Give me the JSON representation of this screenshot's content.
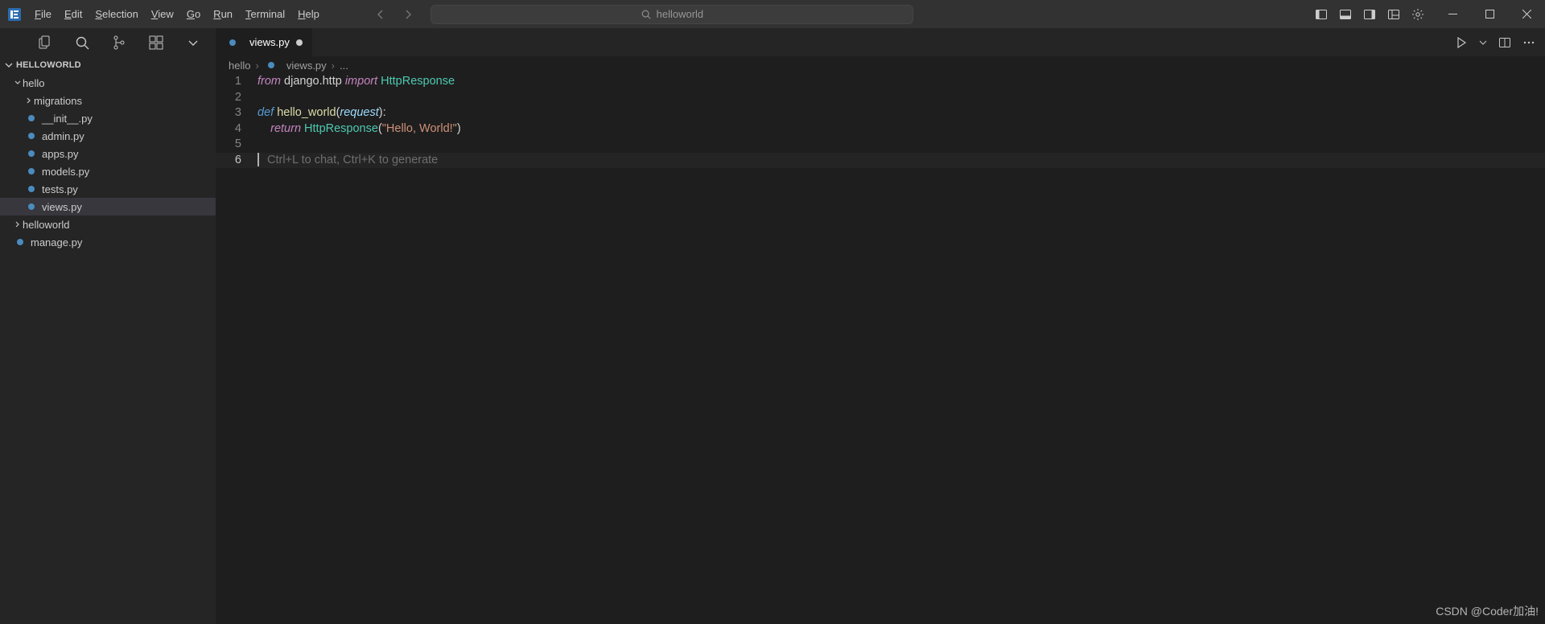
{
  "menubar": {
    "items": [
      {
        "label": "File",
        "mn": "F"
      },
      {
        "label": "Edit",
        "mn": "E"
      },
      {
        "label": "Selection",
        "mn": "S"
      },
      {
        "label": "View",
        "mn": "V"
      },
      {
        "label": "Go",
        "mn": "G"
      },
      {
        "label": "Run",
        "mn": "R"
      },
      {
        "label": "Terminal",
        "mn": "T"
      },
      {
        "label": "Help",
        "mn": "H"
      }
    ]
  },
  "search": {
    "text": "helloworld"
  },
  "explorer": {
    "title": "HELLOWORLD",
    "tree": [
      {
        "type": "folder",
        "label": "hello",
        "depth": 1,
        "open": true
      },
      {
        "type": "folder",
        "label": "migrations",
        "depth": 2,
        "open": false
      },
      {
        "type": "file",
        "label": "__init__.py",
        "depth": 2
      },
      {
        "type": "file",
        "label": "admin.py",
        "depth": 2
      },
      {
        "type": "file",
        "label": "apps.py",
        "depth": 2
      },
      {
        "type": "file",
        "label": "models.py",
        "depth": 2
      },
      {
        "type": "file",
        "label": "tests.py",
        "depth": 2
      },
      {
        "type": "file",
        "label": "views.py",
        "depth": 2,
        "active": true
      },
      {
        "type": "folder",
        "label": "helloworld",
        "depth": 1,
        "open": false
      },
      {
        "type": "file",
        "label": "manage.py",
        "depth": 1
      }
    ]
  },
  "tabs": {
    "open": [
      {
        "label": "views.py",
        "dirty": true
      }
    ]
  },
  "breadcrumb": {
    "parts": [
      "hello",
      "views.py",
      "..."
    ]
  },
  "editor": {
    "ghost_hint": "Ctrl+L to chat, Ctrl+K to generate",
    "current_line": 6,
    "lines": [
      {
        "n": 1,
        "tokens": [
          [
            "kw-imp",
            "from"
          ],
          [
            "mod",
            " django.http "
          ],
          [
            "kw-imp",
            "import"
          ],
          [
            "mod",
            " "
          ],
          [
            "cls",
            "HttpResponse"
          ]
        ]
      },
      {
        "n": 2,
        "tokens": []
      },
      {
        "n": 3,
        "tokens": [
          [
            "kw-def",
            "def"
          ],
          [
            "mod",
            " "
          ],
          [
            "fn",
            "hello_world"
          ],
          [
            "punct",
            "("
          ],
          [
            "param",
            "request"
          ],
          [
            "punct",
            "):"
          ]
        ]
      },
      {
        "n": 4,
        "tokens": [
          [
            "mod",
            "    "
          ],
          [
            "kw-ret",
            "return"
          ],
          [
            "mod",
            " "
          ],
          [
            "cls",
            "HttpResponse"
          ],
          [
            "punct",
            "("
          ],
          [
            "str",
            "\"Hello, World!\""
          ],
          [
            "punct",
            ")"
          ]
        ]
      },
      {
        "n": 5,
        "tokens": []
      },
      {
        "n": 6,
        "tokens": [],
        "cursor": true,
        "ghost": true
      }
    ]
  },
  "watermark": "CSDN @Coder加油!"
}
